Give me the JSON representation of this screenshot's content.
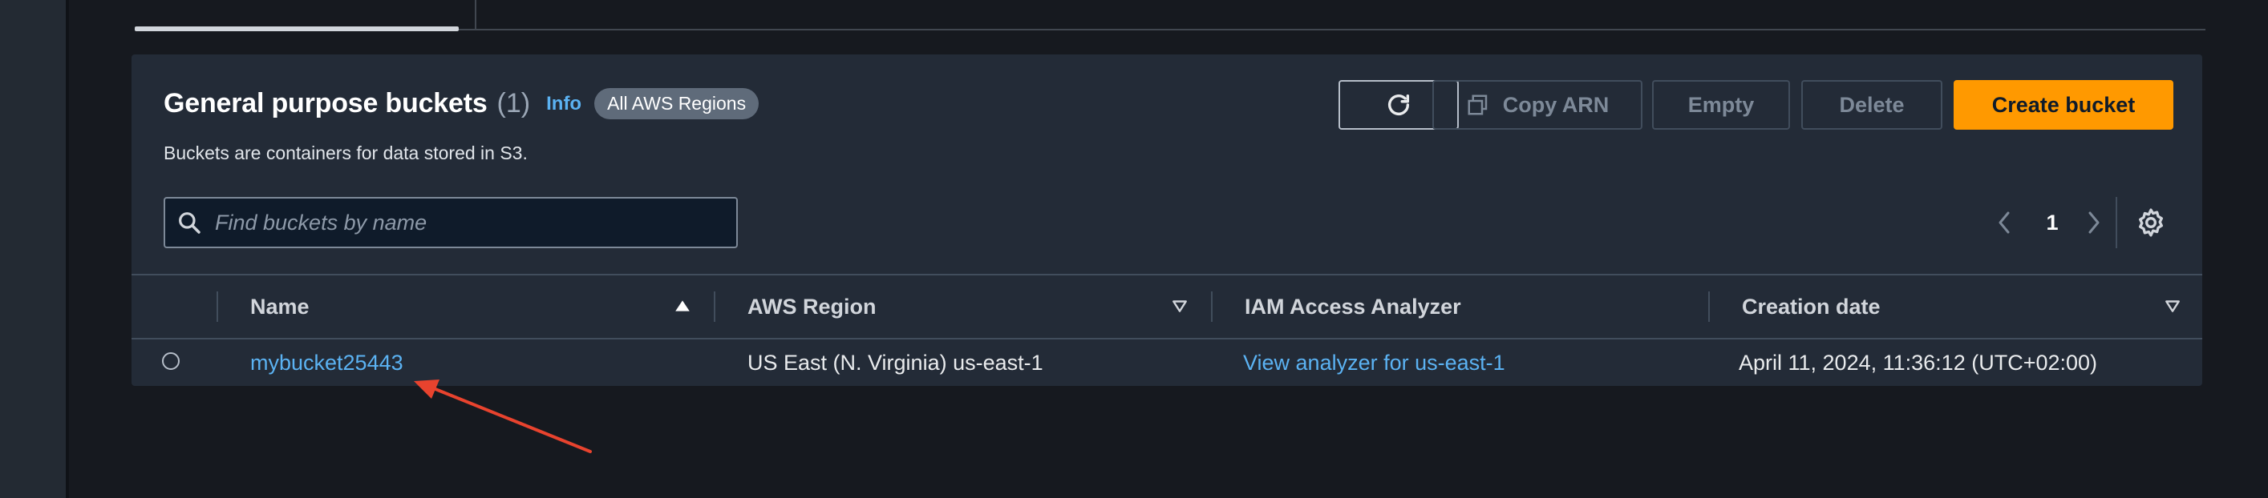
{
  "panel": {
    "title": "General purpose buckets",
    "count": "(1)",
    "info": "Info",
    "badge": "All AWS Regions",
    "description": "Buckets are containers for data stored in S3."
  },
  "toolbar": {
    "refresh_icon": "refresh-icon",
    "copy_arn": "Copy ARN",
    "empty": "Empty",
    "delete": "Delete",
    "create": "Create bucket"
  },
  "search": {
    "placeholder": "Find buckets by name"
  },
  "pagination": {
    "current_page": "1"
  },
  "table": {
    "columns": [
      "Name",
      "AWS Region",
      "IAM Access Analyzer",
      "Creation date"
    ],
    "rows": [
      {
        "name": "mybucket25443",
        "region": "US East (N. Virginia) us-east-1",
        "analyzer": "View analyzer for us-east-1",
        "created": "April 11, 2024, 11:36:12 (UTC+02:00)"
      }
    ]
  },
  "colors": {
    "background": "#16191f",
    "container": "#232b37",
    "accent_orange": "#ff9900",
    "link_blue": "#5bb2f2",
    "annotation_arrow": "#e8432e"
  }
}
